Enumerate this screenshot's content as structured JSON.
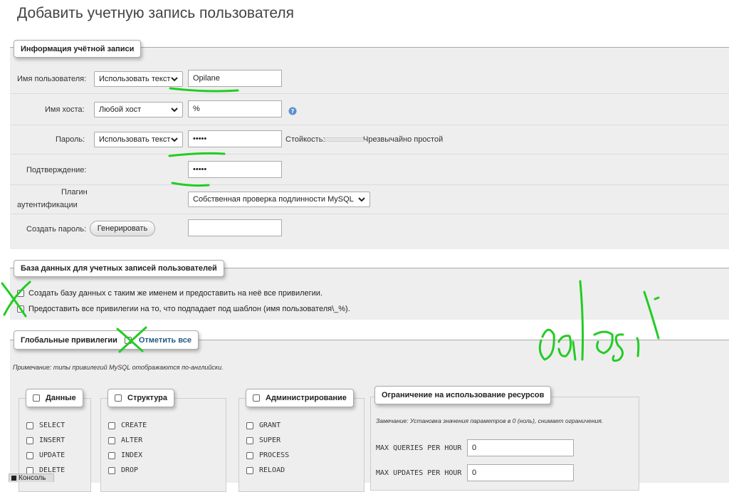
{
  "page": {
    "title": "Добавить учетную запись пользователя"
  },
  "account": {
    "legend": "Информация учётной записи",
    "username": {
      "label": "Имя пользователя:",
      "mode": "Использовать текст",
      "value": "Opilane"
    },
    "host": {
      "label": "Имя хоста:",
      "mode": "Любой хост",
      "value": "%"
    },
    "password": {
      "label": "Пароль:",
      "mode": "Использовать текст",
      "value": "•••••",
      "strength_label": "Стойкость:",
      "strength_text": "Чрезвычайно простой"
    },
    "confirm": {
      "label": "Подтверждение:",
      "value": "•••••"
    },
    "auth_plugin": {
      "label_line1": "Плагин",
      "label_line2": "аутентификации",
      "value": "Собственная проверка подлинности MySQL"
    },
    "generate": {
      "label": "Создать пароль:",
      "button": "Генерировать",
      "value": ""
    }
  },
  "database": {
    "legend": "База данных для учетных записей пользователей",
    "option1": "Создать базу данных с таким же именем и предоставить на неё все привилегии.",
    "option2": "Предоставить все привилегии на то, что подпадает под шаблон (имя пользователя\\_%)."
  },
  "global": {
    "legend": "Глобальные привилегии",
    "check_all": "Отметить все",
    "note": "Примечание: типы привилегий MySQL отображаются по-английски.",
    "groups": [
      {
        "title": "Данные",
        "items": [
          "SELECT",
          "INSERT",
          "UPDATE",
          "DELETE"
        ]
      },
      {
        "title": "Структура",
        "items": [
          "CREATE",
          "ALTER",
          "INDEX",
          "DROP"
        ]
      },
      {
        "title": "Администрирование",
        "items": [
          "GRANT",
          "SUPER",
          "PROCESS",
          "RELOAD"
        ]
      }
    ],
    "limits": {
      "title": "Ограничение на использование ресурсов",
      "note": "Замечание: Установка значения параметров в 0 (ноль), снимает ограничения.",
      "rows": [
        {
          "label": "MAX QUERIES PER HOUR",
          "value": "0"
        },
        {
          "label": "MAX UPDATES PER HOUR",
          "value": "0"
        }
      ]
    }
  },
  "console": {
    "label": "Консоль"
  },
  "colors": {
    "panel_bg": "#eeeeee",
    "annotation_green": "#22cc22",
    "link": "#235a81"
  },
  "annotation": {
    "handwriting": "edasi"
  }
}
